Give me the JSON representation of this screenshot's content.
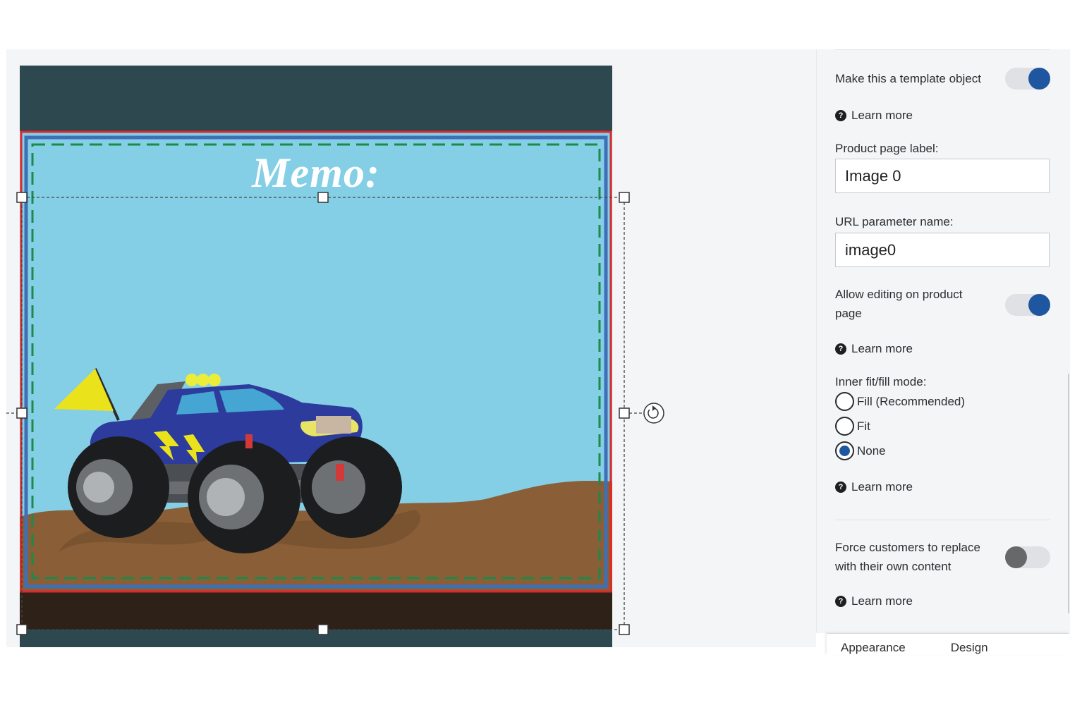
{
  "canvas": {
    "memo_text": "Memo:"
  },
  "panel": {
    "template_object_label": "Make this a template object",
    "template_object_on": true,
    "learn_more": "Learn more",
    "product_page_label_title": "Product page label:",
    "product_page_label_value": "Image 0",
    "url_param_title": "URL parameter name:",
    "url_param_value": "image0",
    "allow_editing_label": "Allow editing on product page",
    "allow_editing_on": true,
    "fit_mode_title": "Inner fit/fill mode:",
    "fit_modes": [
      "Fill (Recommended)",
      "Fit",
      "None"
    ],
    "fit_mode_selected": "None",
    "force_replace_label": "Force customers to replace with their own content",
    "force_replace_on": false,
    "drawer_tabs": [
      "Appearance",
      "Design"
    ]
  },
  "colors": {
    "accent": "#1f56a0",
    "sky": "#84cfe6",
    "ground": "#8a5f37",
    "dark_band": "#2e4850",
    "bottom_band": "#2d2118",
    "bleed_red": "#e0282c",
    "safe_green": "#1b8a4a",
    "truck_blue": "#2d3b9c"
  }
}
